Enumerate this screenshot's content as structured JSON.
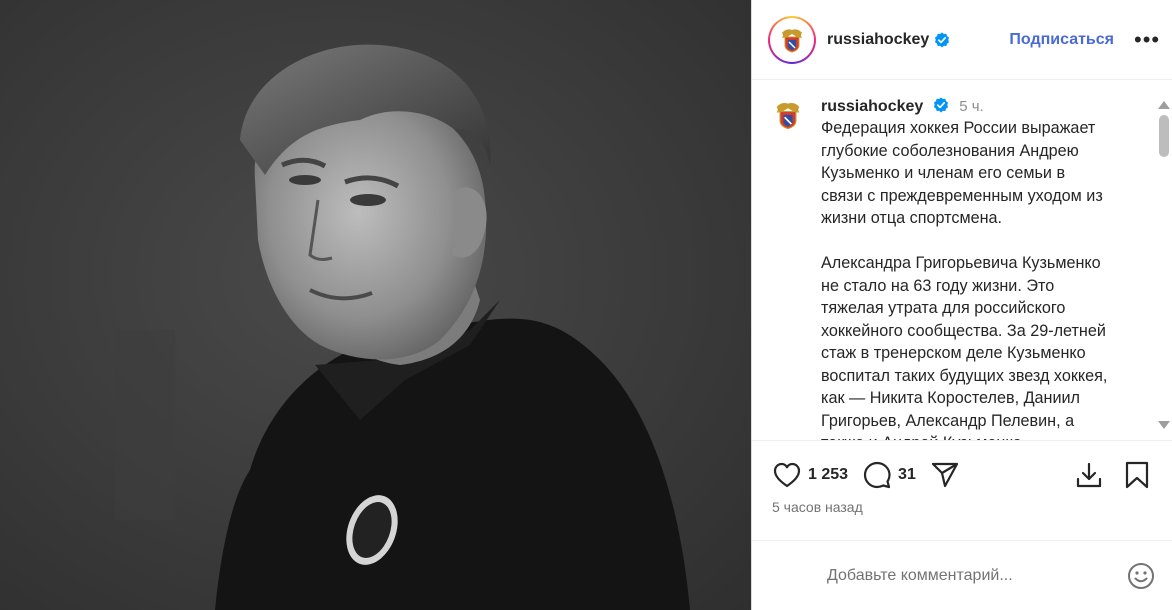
{
  "post": {
    "username": "russiahockey",
    "follow_label": "Подписаться",
    "more_label": "•••",
    "caption": {
      "username": "russiahockey",
      "time": "5 ч.",
      "text": "Федерация хоккея России выражает\nглубокие соболезнования Андрею\nКузьменко и членам его семьи в\nсвязи с преждевременным уходом из\nжизни отца спортсмена.\n\nАлександра Григорьевича Кузьменко\nне стало на 63 году жизни. Это\nтяжелая утрата для российского\nхоккейного сообщества. За 29-летней\nстаж в тренерском деле Кузьменко\nвоспитал таких будущих звезд хоккея,\nкак — Никита Коростелев, Даниил\nГригорьев, Александр Пелевин, а\nтакже и Андрей Кузьменко."
    },
    "likes": "1 253",
    "comments": "31",
    "posted_ago": "5 часов назад",
    "comment_placeholder": "Добавьте комментарий..."
  },
  "colors": {
    "accent": "#4a6bd6",
    "verified": "#0095f6",
    "photo_bg": "#3a3a3a"
  },
  "icons": [
    "verified-badge-icon",
    "more-options-icon",
    "heart-icon",
    "comment-icon",
    "share-icon",
    "download-icon",
    "bookmark-icon",
    "emoji-icon",
    "federation-emblem-icon"
  ]
}
